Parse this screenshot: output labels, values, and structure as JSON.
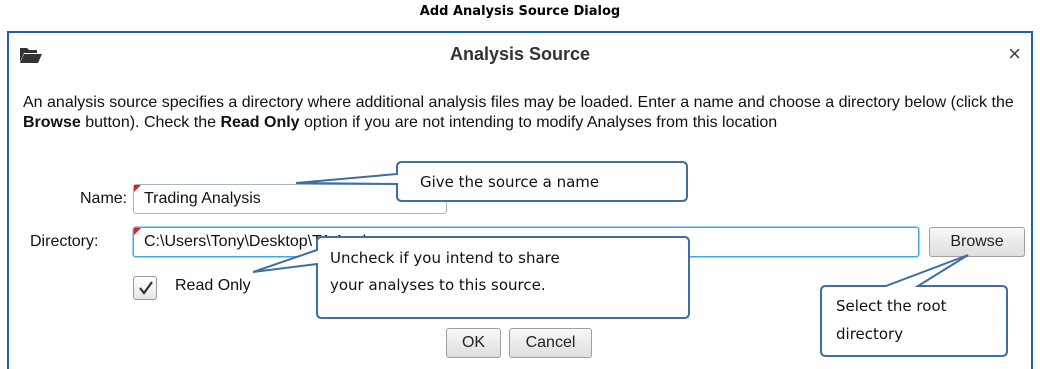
{
  "caption": "Add Analysis Source Dialog",
  "dialog": {
    "title": "Analysis Source",
    "close_glyph": "×",
    "description": {
      "part1": "An analysis source specifies a directory where additional analysis files may be loaded.  Enter a name and choose a directory below (click the ",
      "bold1": "Browse",
      "part2": " button).  Check the ",
      "bold2": "Read Only",
      "part3": " option if you are not intending to modify Analyses from this location"
    },
    "name_label": "Name:",
    "name_value": "Trading Analysis",
    "directory_label": "Directory:",
    "directory_value": "C:\\Users\\Tony\\Desktop\\TA Analyses",
    "browse_label": "Browse",
    "readonly_label": "Read Only",
    "readonly_checked": true,
    "ok_label": "OK",
    "cancel_label": "Cancel"
  },
  "callouts": {
    "name": "Give the source a name",
    "readonly_line1": "Uncheck if you intend to share",
    "readonly_line2": "your analyses to this source.",
    "browse_line1": "Select the root",
    "browse_line2": "directory"
  },
  "icons": {
    "title": "folder-open-icon",
    "close": "close-icon",
    "check": "check-icon"
  },
  "colors": {
    "dialog_border": "#1f5fa6",
    "callout_border": "#3d6fa5",
    "focus_border": "#42a5e6",
    "required_marker": "#e02020"
  }
}
